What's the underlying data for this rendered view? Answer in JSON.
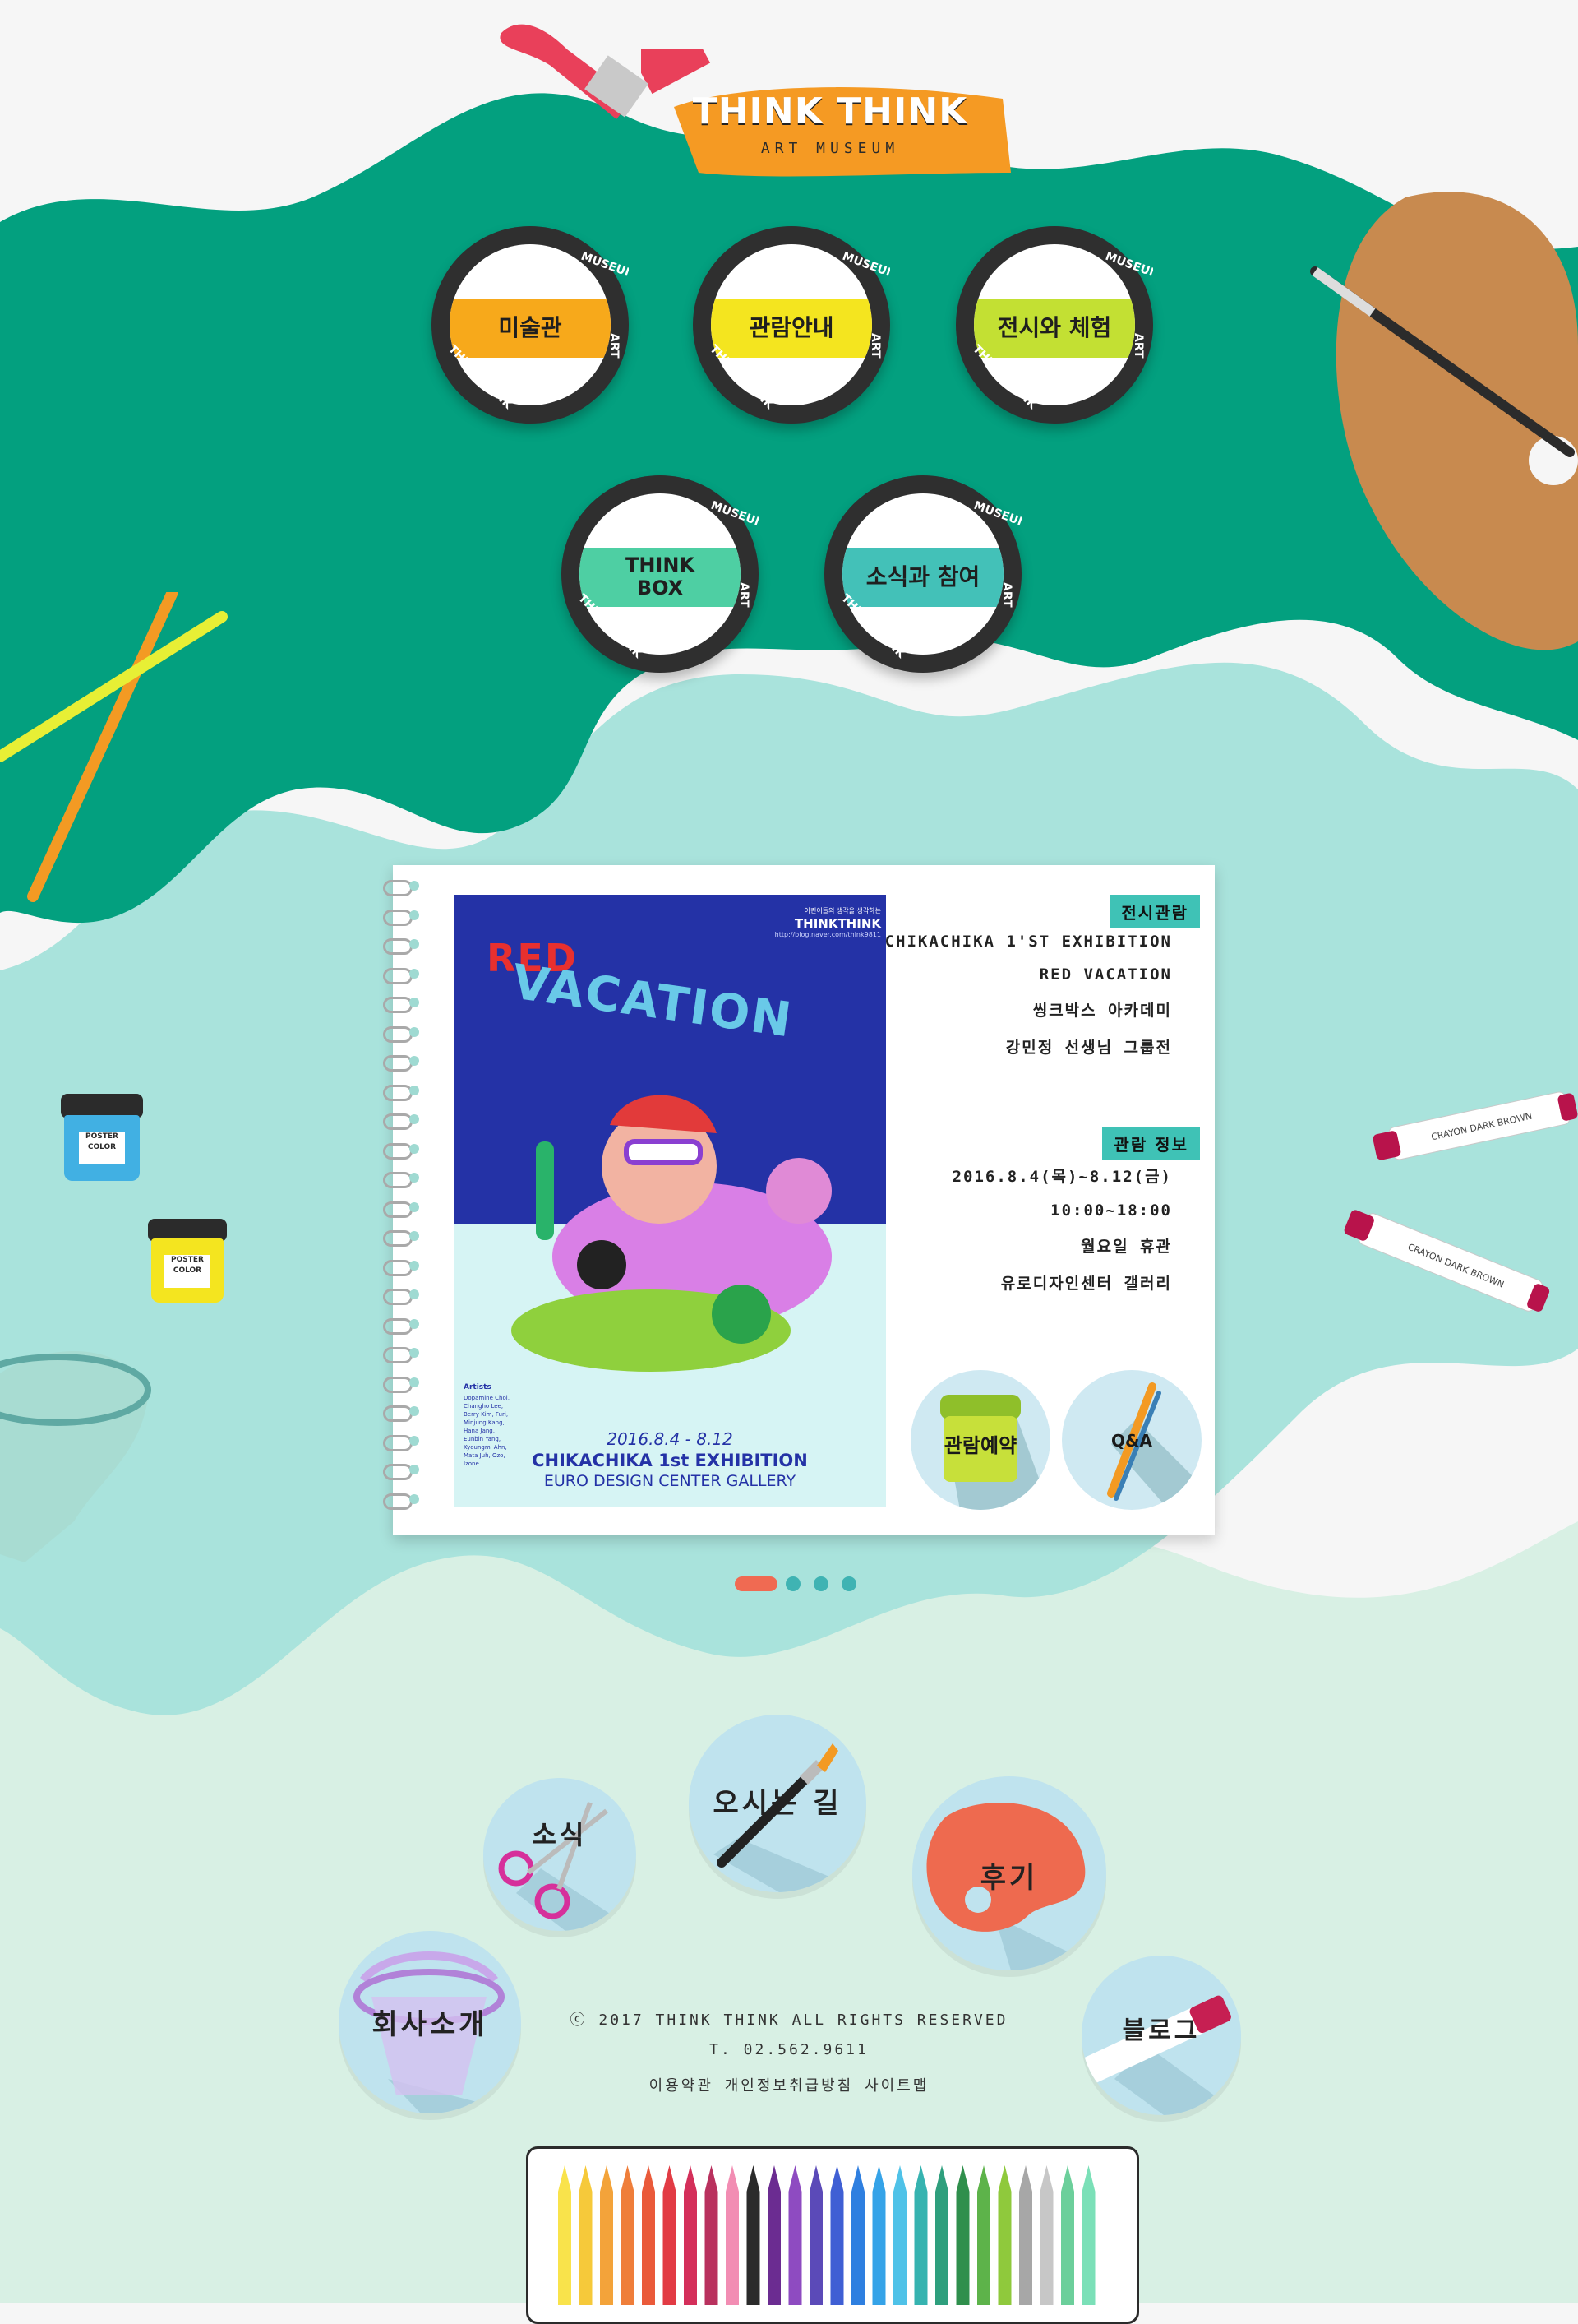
{
  "logo": {
    "title": "THINK THINK",
    "subtitle": "ART MUSEUM"
  },
  "menu": [
    {
      "label": "미술관",
      "color": "#f7a91b"
    },
    {
      "label": "관람안내",
      "color": "#f4e51f"
    },
    {
      "label": "전시와 체험",
      "color": "#c3e033"
    },
    {
      "label": "THINK BOX",
      "color": "#4ecfa3"
    },
    {
      "label": "소식과 참여",
      "color": "#43c1b8"
    }
  ],
  "badge_ring": {
    "top": "MUSEUM",
    "right": "ART",
    "left": "THINK THINK"
  },
  "poster": {
    "brand_small": "어린이들의 생각을 생각하는",
    "brand": "THINKTHINK",
    "url": "http://blog.naver.com/think9811",
    "title_word1": "RED",
    "title_word2": "VACATION",
    "artists_label": "Artists",
    "artists": "Dopamine Choi, Changho Lee, Berry Kim, Furi, Minjung Kang, Hana Jang, Eunbin Yang, Kyoungmi Ahn, Mata Juh, Ozo, Izone.",
    "dates": "2016.8.4 - 8.12",
    "event": "CHIKACHIKA 1st EXHIBITION",
    "venue": "EURO DESIGN CENTER GALLERY"
  },
  "exhibition": {
    "tag": "전시관람",
    "lines": [
      "CHIKACHIKA 1'ST EXHIBITION",
      "RED VACATION",
      "씽크박스 아카데미",
      "강민정 선생님 그룹전"
    ]
  },
  "info": {
    "tag": "관람 정보",
    "lines": [
      "2016.8.4(목)~8.12(금)",
      "10:00~18:00",
      "월요일 휴관",
      "유로디자인센터 갤러리"
    ]
  },
  "actions": {
    "reserve": "관람예약",
    "qna": "Q&A"
  },
  "pager": {
    "count": 4,
    "active": 1
  },
  "nav": [
    {
      "label": "소식"
    },
    {
      "label": "오시는 길"
    },
    {
      "label": "후기"
    },
    {
      "label": "회사소개"
    },
    {
      "label": "블로그"
    }
  ],
  "decor": {
    "paint_label": "POSTER COLOR",
    "crayon_label": "CRAYON DARK BROWN"
  },
  "footer": {
    "copyright": "ⓒ 2017 THINK THINK ALL RIGHTS RESERVED",
    "tel": "T. 02.562.9611",
    "links": [
      "이용약관",
      "개인정보취급방침",
      "사이트맵"
    ]
  }
}
